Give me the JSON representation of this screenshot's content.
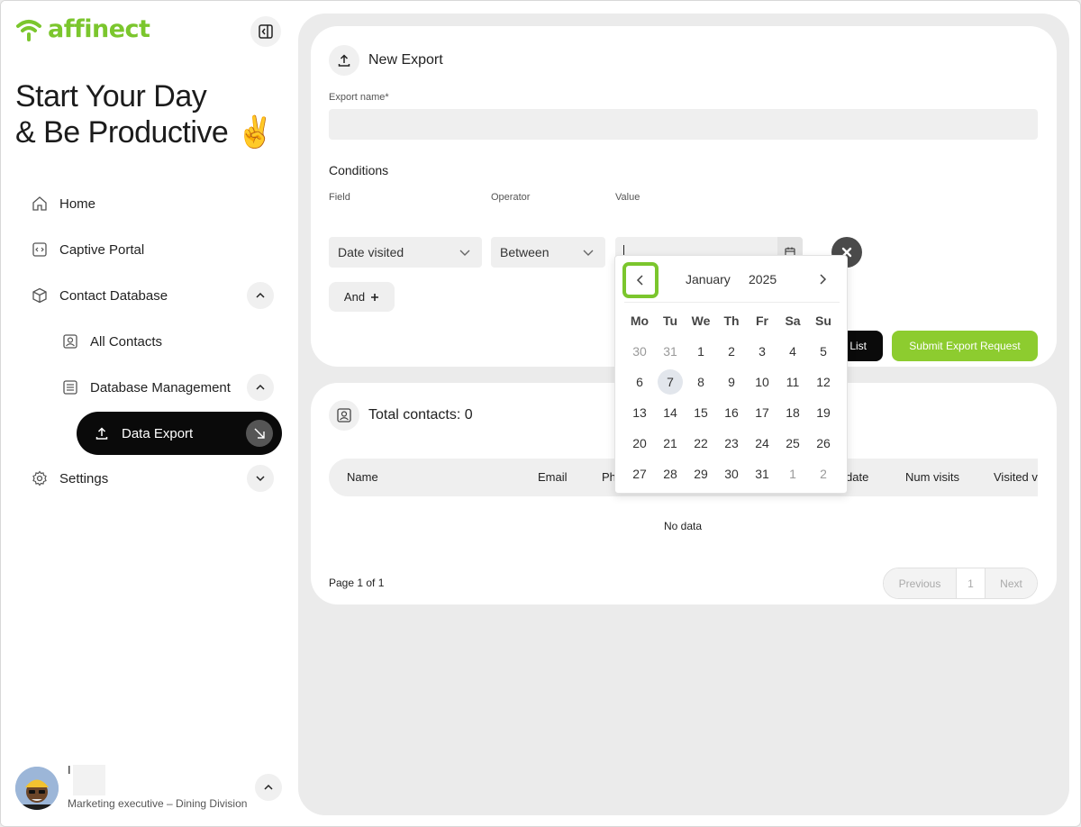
{
  "brand": {
    "name": "affinect",
    "accent": "#7bc62d"
  },
  "sidebar": {
    "tagline_line1": "Start Your Day",
    "tagline_line2": "& Be Productive",
    "tagline_emoji": "✌️",
    "nav": {
      "home": "Home",
      "captive_portal": "Captive Portal",
      "contact_database": "Contact Database",
      "all_contacts": "All Contacts",
      "database_management": "Database Management",
      "data_export": "Data Export",
      "settings": "Settings"
    },
    "user": {
      "name": "I",
      "role": "Marketing executive – Dining Division"
    }
  },
  "export_form": {
    "title": "New Export",
    "export_name_label": "Export name*",
    "export_name_value": "",
    "conditions_title": "Conditions",
    "field_label": "Field",
    "operator_label": "Operator",
    "value_label": "Value",
    "field_value": "Date visited",
    "operator_value": "Between",
    "and_label": "And",
    "save_list_label": "List",
    "submit_label": "Submit Export Request"
  },
  "contacts": {
    "total_label": "Total contacts: 0",
    "columns": [
      "Name",
      "Email",
      "Phone",
      "date",
      "Num visits",
      "Visited ve"
    ],
    "empty_text": "No data",
    "page_info": "Page 1 of 1",
    "pager": {
      "previous": "Previous",
      "current": "1",
      "next": "Next"
    }
  },
  "calendar": {
    "month": "January",
    "year": "2025",
    "weekdays": [
      "Mo",
      "Tu",
      "We",
      "Th",
      "Fr",
      "Sa",
      "Su"
    ],
    "days": [
      {
        "d": "30",
        "muted": true
      },
      {
        "d": "31",
        "muted": true
      },
      {
        "d": "1"
      },
      {
        "d": "2"
      },
      {
        "d": "3"
      },
      {
        "d": "4"
      },
      {
        "d": "5"
      },
      {
        "d": "6"
      },
      {
        "d": "7",
        "today": true
      },
      {
        "d": "8"
      },
      {
        "d": "9"
      },
      {
        "d": "10"
      },
      {
        "d": "11"
      },
      {
        "d": "12"
      },
      {
        "d": "13"
      },
      {
        "d": "14"
      },
      {
        "d": "15"
      },
      {
        "d": "16"
      },
      {
        "d": "17"
      },
      {
        "d": "18"
      },
      {
        "d": "19"
      },
      {
        "d": "20"
      },
      {
        "d": "21"
      },
      {
        "d": "22"
      },
      {
        "d": "23"
      },
      {
        "d": "24"
      },
      {
        "d": "25"
      },
      {
        "d": "26"
      },
      {
        "d": "27"
      },
      {
        "d": "28"
      },
      {
        "d": "29"
      },
      {
        "d": "30"
      },
      {
        "d": "31"
      },
      {
        "d": "1",
        "muted": true
      },
      {
        "d": "2",
        "muted": true
      }
    ]
  }
}
